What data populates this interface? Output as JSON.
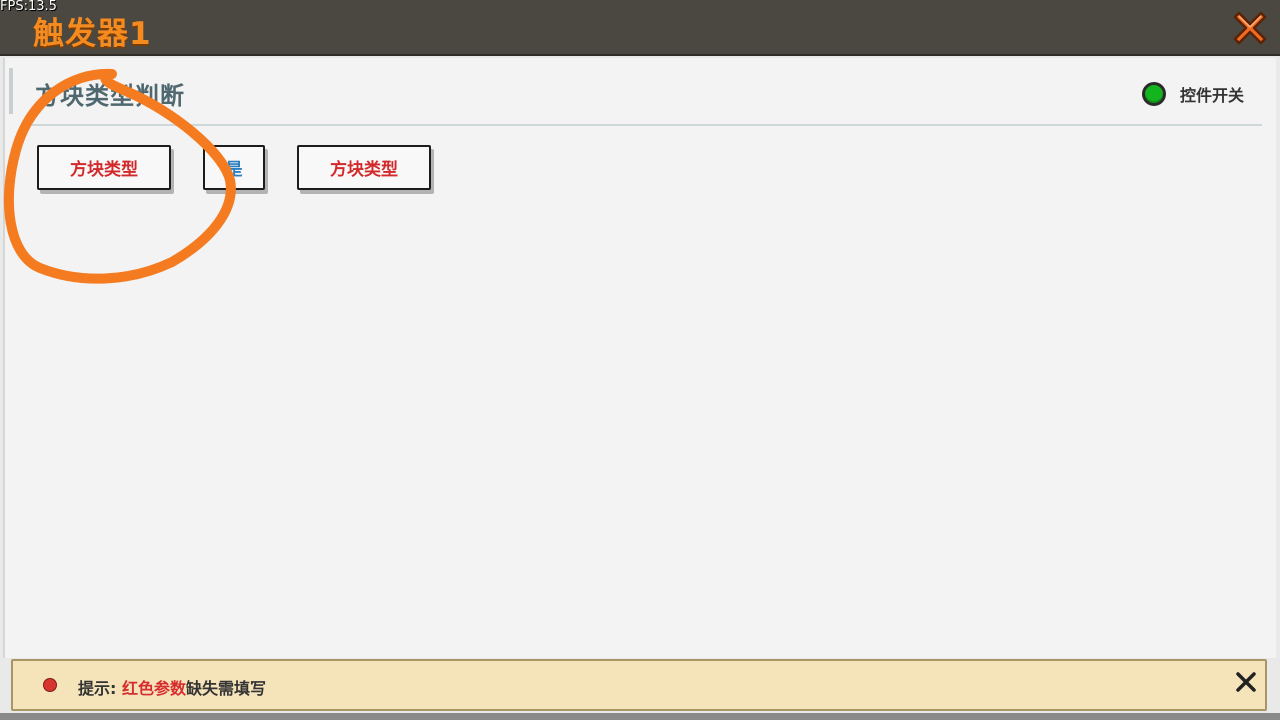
{
  "fps": "FPS:13.5",
  "window": {
    "title": "触发器1",
    "close_icon": "close-x-icon"
  },
  "section": {
    "title": "方块类型判断",
    "toggle_label": "控件开关",
    "toggle_on": true
  },
  "params": [
    {
      "label": "方块类型",
      "color": "#d22a2a"
    },
    {
      "label": "是",
      "color": "#2a7fc0"
    },
    {
      "label": "方块类型",
      "color": "#d22a2a"
    }
  ],
  "hint": {
    "prefix": "提示:",
    "highlight": "红色参数",
    "suffix": "缺失需填写"
  },
  "colors": {
    "accent": "#f58b1f",
    "toggle_on": "#14b41e",
    "missing_param": "#d22a2a",
    "hint_bg": "#f5e3ba"
  }
}
